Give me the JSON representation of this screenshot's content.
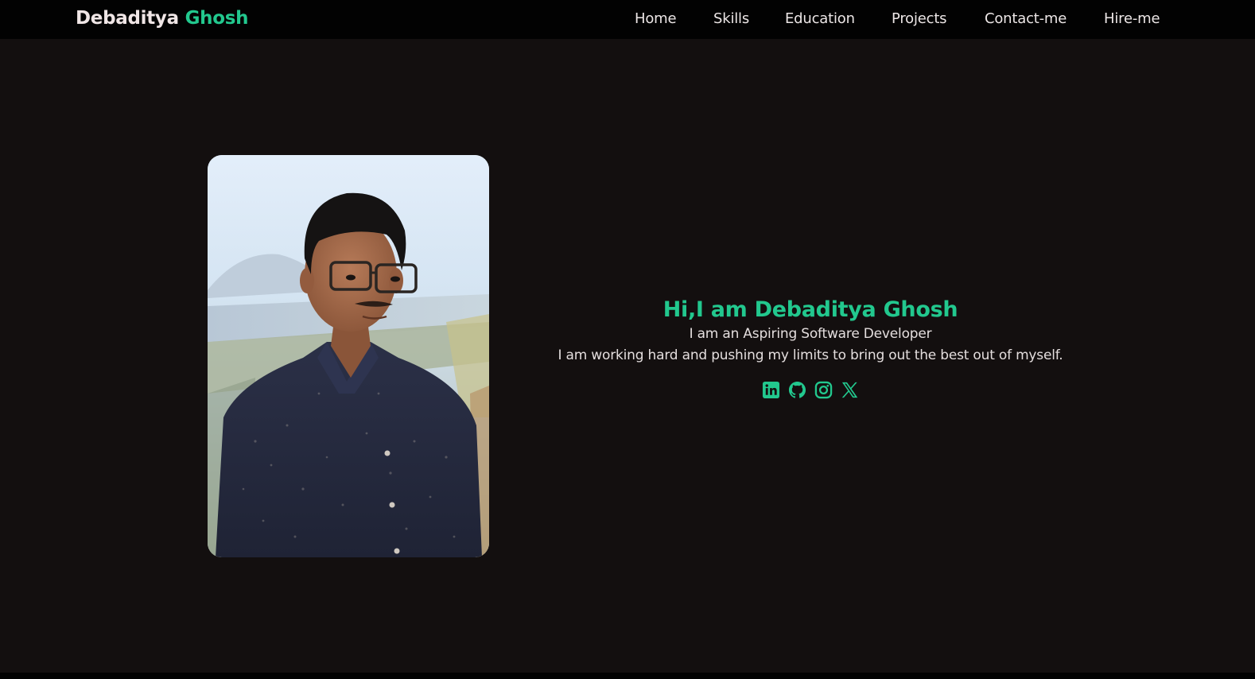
{
  "brand": {
    "first": "Debaditya",
    "last": "Ghosh"
  },
  "nav": {
    "items": [
      {
        "label": "Home"
      },
      {
        "label": "Skills"
      },
      {
        "label": "Education"
      },
      {
        "label": "Projects"
      },
      {
        "label": "Contact-me"
      },
      {
        "label": "Hire-me"
      }
    ]
  },
  "hero": {
    "headline": "Hi,I am Debaditya Ghosh",
    "tagline": "I am an Aspiring Software Developer",
    "subline": "I am working hard and pushing my limits to bring out the best out of myself."
  },
  "socials": [
    {
      "icon": "linkedin-icon"
    },
    {
      "icon": "github-icon"
    },
    {
      "icon": "instagram-icon"
    },
    {
      "icon": "x-twitter-icon"
    }
  ],
  "colors": {
    "accent": "#22c88e",
    "background": "#130f0f",
    "navbar": "#020202",
    "text": "#e8e2e2"
  }
}
